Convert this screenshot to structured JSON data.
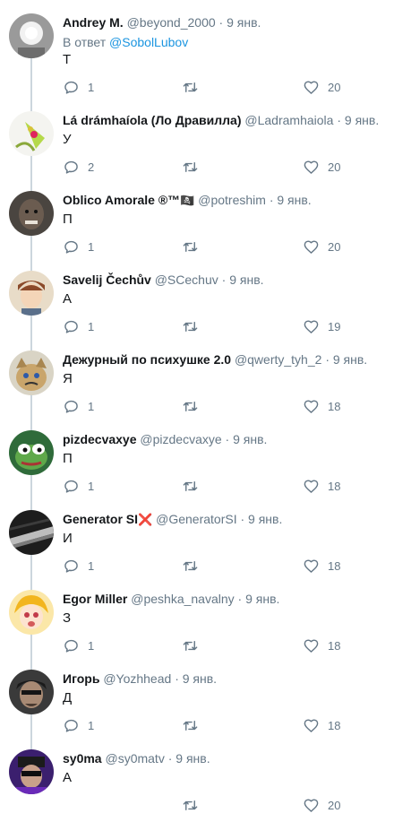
{
  "colors": {
    "name": "#14171a",
    "meta": "#657786",
    "link": "#1b95e0",
    "thread_line": "#ccd6dd",
    "red_x": "#e0245e"
  },
  "icons": {
    "reply": "reply-bubble-icon",
    "retweet": "retweet-icon",
    "like": "heart-icon"
  },
  "tweets": [
    {
      "name": "Andrey M.",
      "handle": "@beyond_2000",
      "date": "9 янв.",
      "reply_prefix": "В ответ",
      "reply_to": "@SobolLubov",
      "text": "Т",
      "replies": "1",
      "retweets": "",
      "likes": "20"
    },
    {
      "name": "Lá drámhaíola (Ло Дравилла)",
      "handle": "@Ladramhaiola",
      "date": "9 янв.",
      "text": "У",
      "replies": "2",
      "retweets": "",
      "likes": "20"
    },
    {
      "name": "Oblico Amorale ®™",
      "emoji": "🏴‍☠️",
      "handle": "@potreshim",
      "date": "9 янв.",
      "text": "П",
      "replies": "1",
      "retweets": "",
      "likes": "20"
    },
    {
      "name": "Savelij Čechův",
      "handle": "@SCechuv",
      "date": "9 янв.",
      "text": "А",
      "replies": "1",
      "retweets": "",
      "likes": "19"
    },
    {
      "name": "Дежурный по психушке 2.0",
      "handle": "@qwerty_tyh_2",
      "date": "9 янв.",
      "text": "Я",
      "replies": "1",
      "retweets": "",
      "likes": "18"
    },
    {
      "name": "pizdecvaxye",
      "handle": "@pizdecvaxye",
      "date": "9 янв.",
      "text": "П",
      "replies": "1",
      "retweets": "",
      "likes": "18"
    },
    {
      "name": "Generator SI",
      "emoji": "❌",
      "handle": "@GeneratorSI",
      "date": "9 янв.",
      "text": "И",
      "replies": "1",
      "retweets": "",
      "likes": "18"
    },
    {
      "name": "Egor Miller",
      "handle": "@peshka_navalny",
      "date": "9 янв.",
      "text": "З",
      "replies": "1",
      "retweets": "",
      "likes": "18"
    },
    {
      "name": "Игорь",
      "handle": "@Yozhhead",
      "date": "9 янв.",
      "text": "Д",
      "replies": "1",
      "retweets": "",
      "likes": "18"
    },
    {
      "name": "sy0ma",
      "handle": "@sy0matv",
      "date": "9 янв.",
      "text": "А",
      "replies": "",
      "retweets": "",
      "likes": "20"
    }
  ]
}
